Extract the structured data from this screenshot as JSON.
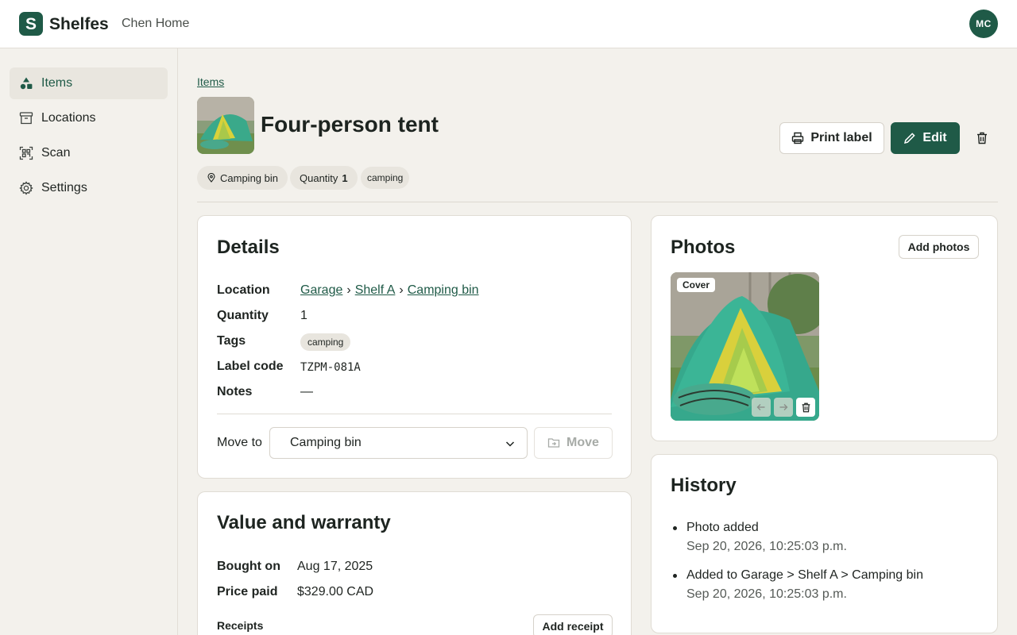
{
  "app": {
    "brand": "Shelfes",
    "logo_letter": "S",
    "workspace": "Chen Home",
    "user_initials": "MC",
    "accent": "#1f5a47"
  },
  "sidebar": {
    "items": [
      {
        "label": "Items",
        "icon": "shapes-icon",
        "active": true
      },
      {
        "label": "Locations",
        "icon": "archive-box-icon",
        "active": false
      },
      {
        "label": "Scan",
        "icon": "scan-qr-icon",
        "active": false
      },
      {
        "label": "Settings",
        "icon": "gear-icon",
        "active": false
      }
    ]
  },
  "header": {
    "breadcrumb": "Items",
    "title": "Four-person tent",
    "print_label": "Print label",
    "edit_label": "Edit",
    "chips": {
      "location": "Camping bin",
      "quantity_label": "Quantity",
      "quantity_value": "1",
      "tag": "camping"
    }
  },
  "details": {
    "title": "Details",
    "location_label": "Location",
    "location_path": [
      "Garage",
      "Shelf A",
      "Camping bin"
    ],
    "path_separator": "›",
    "quantity_label": "Quantity",
    "quantity_value": "1",
    "tags_label": "Tags",
    "tags": [
      "camping"
    ],
    "label_code_label": "Label code",
    "label_code_value": "TZPM-081A",
    "notes_label": "Notes",
    "notes_value": "—",
    "move_to_label": "Move to",
    "move_to_selected": "Camping bin",
    "move_button": "Move"
  },
  "value": {
    "title": "Value and warranty",
    "bought_on_label": "Bought on",
    "bought_on_value": "Aug 17, 2025",
    "price_label": "Price paid",
    "price_value": "$329.00 CAD",
    "receipts_label": "Receipts",
    "add_receipt": "Add receipt"
  },
  "photos": {
    "title": "Photos",
    "add_photos": "Add photos",
    "cover_badge": "Cover"
  },
  "history": {
    "title": "History",
    "entries": [
      {
        "text": "Photo added",
        "time": "Sep 20, 2026, 10:25:03 p.m."
      },
      {
        "text": "Added to Garage > Shelf A > Camping bin",
        "time": "Sep 20, 2026, 10:25:03 p.m."
      }
    ]
  }
}
